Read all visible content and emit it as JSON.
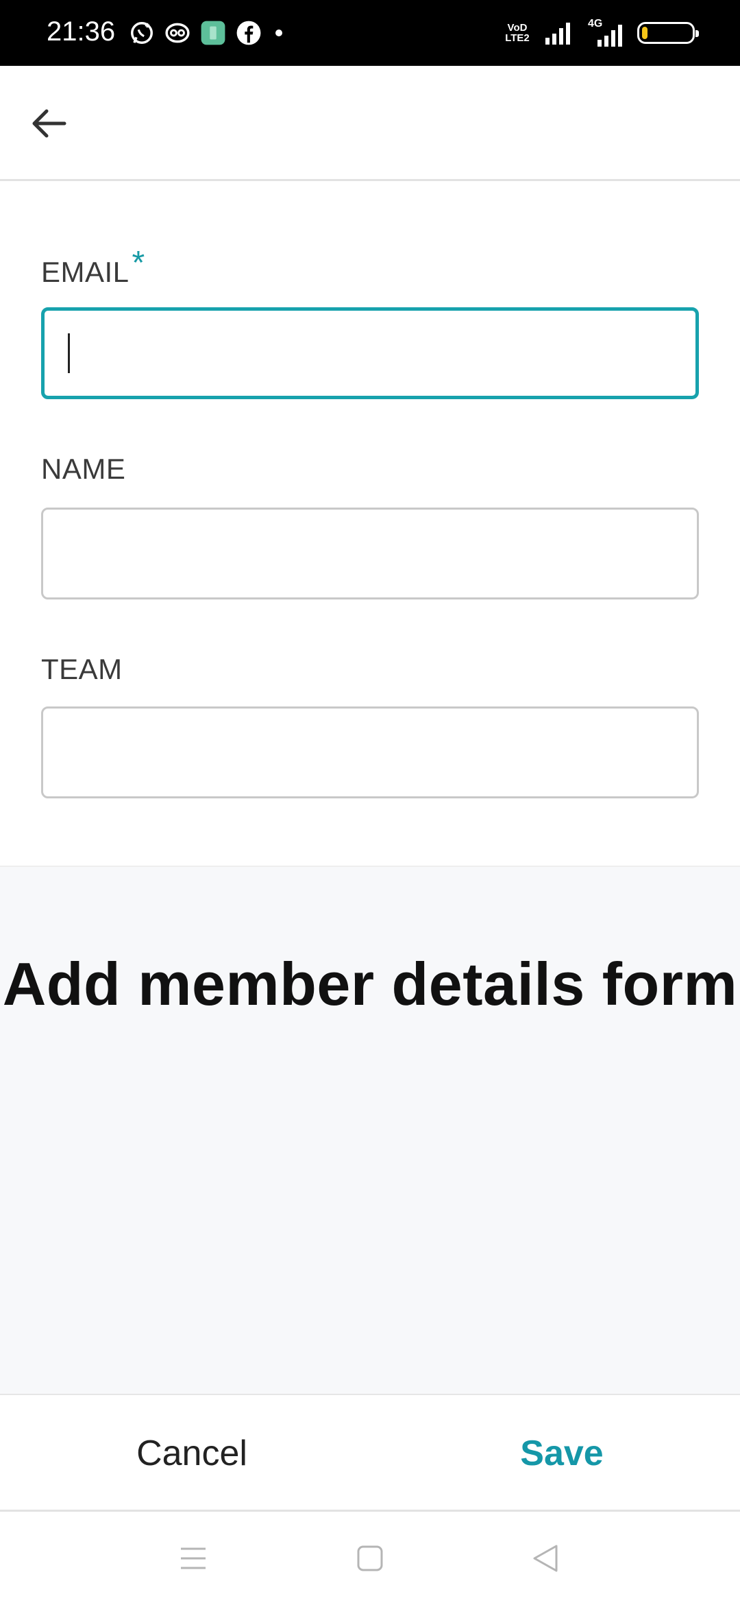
{
  "status_bar": {
    "time": "21:36",
    "left_icons": [
      "whatsapp-icon",
      "chat-icon",
      "app-icon",
      "facebook-icon",
      "dot-icon"
    ],
    "volte_text": "VoD LTE2",
    "network_text": "4G",
    "battery_color": "#f5c518"
  },
  "header": {
    "back_icon": "arrow-left-icon"
  },
  "form": {
    "email": {
      "label": "EMAIL",
      "required_mark": "*",
      "value": "",
      "placeholder": ""
    },
    "name": {
      "label": "NAME",
      "value": "",
      "placeholder": ""
    },
    "team": {
      "label": "TEAM",
      "value": "",
      "placeholder": ""
    },
    "accent_color": "#17a2ad"
  },
  "caption": "Add member details form",
  "actions": {
    "cancel_label": "Cancel",
    "save_label": "Save",
    "save_color": "#1597a8"
  },
  "nav_bar": {
    "icons": [
      "menu-icon",
      "home-square-icon",
      "back-triangle-icon"
    ]
  }
}
